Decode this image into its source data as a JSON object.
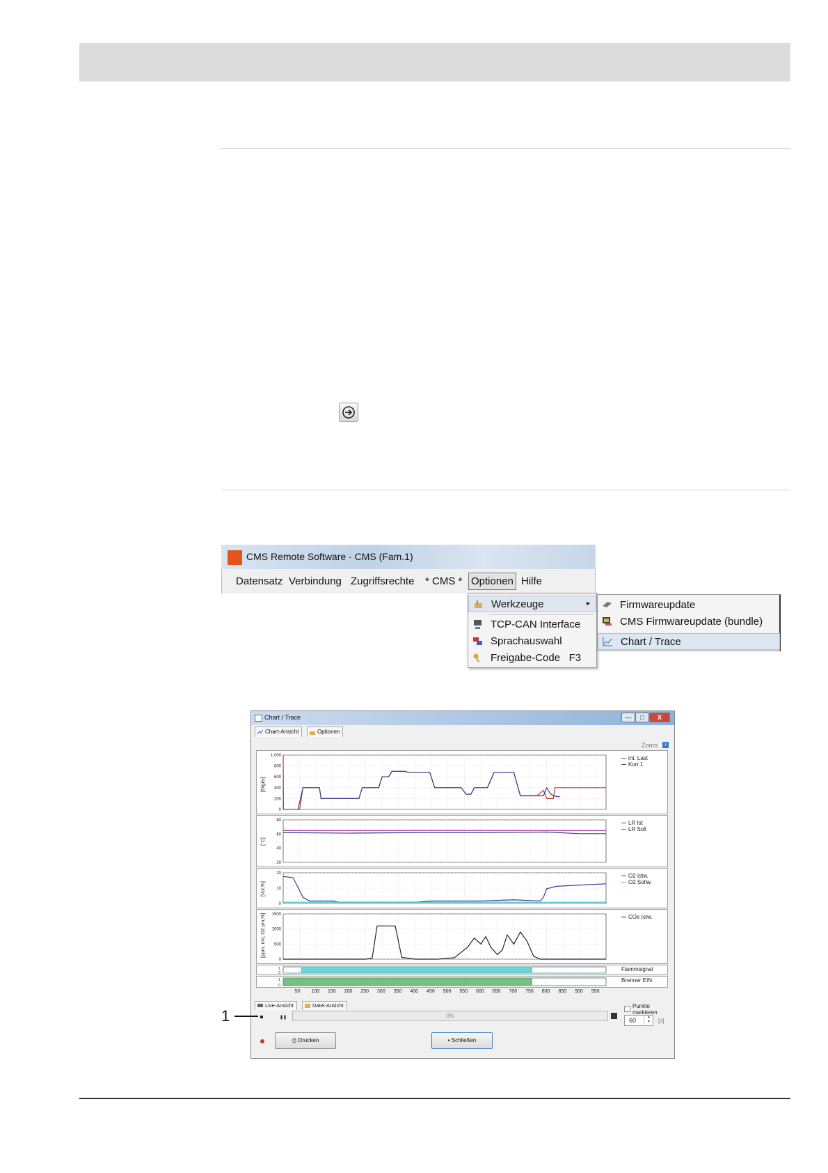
{
  "menu_screenshot": {
    "title": "CMS Remote Software  ·  CMS (Fam.1)",
    "menubar": [
      "Datensatz",
      "Verbindung",
      "Zugriffsrechte",
      "* CMS *",
      "Optionen",
      "Hilfe"
    ],
    "dropdown": [
      {
        "label": "Werkzeuge",
        "icon": "tools-icon",
        "submenu_arrow": "▸"
      },
      {
        "label": "TCP-CAN Interface",
        "icon": "network-icon"
      },
      {
        "label": "Sprachauswahl",
        "icon": "language-flag-icon"
      },
      {
        "label": "Freigabe-Code",
        "shortcut": "F3",
        "icon": "key-icon"
      }
    ],
    "submenu": [
      {
        "label": "Firmwareupdate",
        "icon": "chip-icon"
      },
      {
        "label": "CMS Firmwareupdate (bundle)",
        "icon": "bundle-icon"
      },
      {
        "label": "Chart / Trace",
        "icon": "chart-icon"
      }
    ]
  },
  "trace_window": {
    "title": "Chart / Trace",
    "window_buttons": {
      "minimize": "—",
      "maximize": "□",
      "close": "X"
    },
    "tabs": [
      "Chart-Ansicht",
      "Optionen"
    ],
    "zoom_label": "Zoom",
    "zoom_icon": "i",
    "bottom_tabs": [
      "Live-Ansicht",
      "Datei-Ansicht"
    ],
    "progress_text": "0%",
    "checkbox_label": "Punkte markieren",
    "seconds_value": "60",
    "seconds_unit": "[s]",
    "print_button": "Drucken",
    "close_button": "Schließen",
    "colors": {
      "red": "#c0392b",
      "blue": "#3b3d8f",
      "purple": "#a23fa2",
      "cyan": "#3fc6cc",
      "green": "#4aaa5a",
      "black": "#222222"
    }
  },
  "callout": {
    "number": "1"
  },
  "chart_data": [
    {
      "type": "line",
      "ylabel": "[Digits]",
      "ylim": [
        0,
        1000
      ],
      "yticks": [
        "1.000",
        "800",
        "600",
        "400",
        "200",
        "0"
      ],
      "xlim": [
        0,
        980
      ],
      "series": [
        {
          "name": "int. Last",
          "color": "#c0392b",
          "points": [
            [
              0,
              1000
            ],
            [
              1,
              0
            ],
            [
              50,
              0
            ],
            [
              60,
              400
            ],
            [
              110,
              400
            ],
            [
              115,
              200
            ],
            [
              230,
              200
            ],
            [
              240,
              400
            ],
            [
              290,
              400
            ],
            [
              300,
              600
            ],
            [
              320,
              600
            ],
            [
              330,
              700
            ],
            [
              370,
              700
            ],
            [
              380,
              680
            ],
            [
              445,
              680
            ],
            [
              460,
              400
            ],
            [
              540,
              400
            ],
            [
              555,
              280
            ],
            [
              570,
              280
            ],
            [
              580,
              400
            ],
            [
              620,
              400
            ],
            [
              640,
              680
            ],
            [
              700,
              680
            ],
            [
              720,
              250
            ],
            [
              770,
              250
            ],
            [
              790,
              350
            ],
            [
              800,
              200
            ],
            [
              820,
              200
            ],
            [
              825,
              400
            ],
            [
              980,
              400
            ]
          ]
        },
        {
          "name": "Korr.1",
          "color": "#3b3d8f",
          "points": [
            [
              45,
              0
            ],
            [
              60,
              400
            ],
            [
              110,
              400
            ],
            [
              115,
              200
            ],
            [
              230,
              200
            ],
            [
              240,
              400
            ],
            [
              290,
              400
            ],
            [
              300,
              600
            ],
            [
              320,
              600
            ],
            [
              330,
              700
            ],
            [
              370,
              700
            ],
            [
              380,
              680
            ],
            [
              445,
              680
            ],
            [
              460,
              400
            ],
            [
              540,
              400
            ],
            [
              555,
              280
            ],
            [
              570,
              280
            ],
            [
              580,
              400
            ],
            [
              620,
              400
            ],
            [
              640,
              680
            ],
            [
              700,
              680
            ],
            [
              720,
              250
            ],
            [
              770,
              250
            ],
            [
              790,
              250
            ],
            [
              800,
              400
            ],
            [
              810,
              300
            ],
            [
              820,
              250
            ],
            [
              840,
              230
            ]
          ]
        }
      ]
    },
    {
      "type": "line",
      "ylabel": "[°C]",
      "ylim": [
        10,
        90
      ],
      "yticks": [
        "80",
        "60",
        "40",
        "20"
      ],
      "xlim": [
        0,
        980
      ],
      "series": [
        {
          "name": "LR Ist",
          "color": "#3b3d8f",
          "points": [
            [
              0,
              66
            ],
            [
              200,
              65
            ],
            [
              400,
              66
            ],
            [
              600,
              66
            ],
            [
              800,
              67
            ],
            [
              900,
              64
            ],
            [
              980,
              64
            ]
          ]
        },
        {
          "name": "LR Soll",
          "color": "#a23fa2",
          "points": [
            [
              0,
              70
            ],
            [
              980,
              70
            ]
          ]
        }
      ]
    },
    {
      "type": "line",
      "ylabel": "[Vol.%]",
      "ylim": [
        0,
        25
      ],
      "yticks": [
        "20",
        "10",
        "0"
      ],
      "xlim": [
        0,
        980
      ],
      "series": [
        {
          "name": "O2 Istw.",
          "color": "#3b3d8f",
          "points": [
            [
              0,
              22
            ],
            [
              30,
              21
            ],
            [
              60,
              5
            ],
            [
              80,
              2
            ],
            [
              150,
              2
            ],
            [
              170,
              1
            ],
            [
              400,
              1
            ],
            [
              450,
              2
            ],
            [
              600,
              2
            ],
            [
              700,
              3
            ],
            [
              780,
              2
            ],
            [
              790,
              5
            ],
            [
              800,
              12
            ],
            [
              830,
              14
            ],
            [
              900,
              15
            ],
            [
              980,
              16
            ]
          ]
        },
        {
          "name": "O2 Sollw.",
          "color": "#3fc6cc",
          "points": [
            [
              0,
              1
            ],
            [
              980,
              1
            ]
          ]
        }
      ]
    },
    {
      "type": "line",
      "ylabel": "[ppm, mV, O2 pm,%]",
      "ylim": [
        0,
        1500
      ],
      "yticks": [
        "1500",
        "1000",
        "500",
        "0"
      ],
      "xlim": [
        0,
        980
      ],
      "series": [
        {
          "name": "COe Istw.",
          "color": "#222222",
          "points": [
            [
              0,
              0
            ],
            [
              250,
              0
            ],
            [
              270,
              30
            ],
            [
              285,
              1100
            ],
            [
              340,
              1100
            ],
            [
              360,
              60
            ],
            [
              400,
              0
            ],
            [
              470,
              0
            ],
            [
              520,
              50
            ],
            [
              560,
              400
            ],
            [
              580,
              700
            ],
            [
              600,
              500
            ],
            [
              615,
              750
            ],
            [
              630,
              400
            ],
            [
              650,
              150
            ],
            [
              665,
              300
            ],
            [
              680,
              800
            ],
            [
              700,
              500
            ],
            [
              720,
              900
            ],
            [
              740,
              600
            ],
            [
              760,
              100
            ],
            [
              780,
              0
            ],
            [
              980,
              0
            ]
          ]
        }
      ]
    },
    {
      "type": "area",
      "series": [
        {
          "name": "Flammsignal",
          "color": "#3fc6cc",
          "points": [
            [
              0,
              0
            ],
            [
              55,
              0
            ],
            [
              55,
              1
            ],
            [
              755,
              1
            ],
            [
              755,
              0
            ],
            [
              980,
              0
            ]
          ]
        }
      ],
      "yticks": [
        "1",
        "0"
      ]
    },
    {
      "type": "area",
      "series": [
        {
          "name": "Brenner EIN",
          "color": "#4aaa5a",
          "points": [
            [
              0,
              1
            ],
            [
              755,
              1
            ],
            [
              755,
              0
            ],
            [
              980,
              0
            ]
          ]
        }
      ],
      "yticks": [
        "1",
        "0"
      ]
    }
  ],
  "x_axis": {
    "ticks": [
      50,
      100,
      150,
      200,
      250,
      300,
      350,
      400,
      450,
      500,
      550,
      600,
      650,
      700,
      750,
      800,
      850,
      900,
      950
    ]
  }
}
